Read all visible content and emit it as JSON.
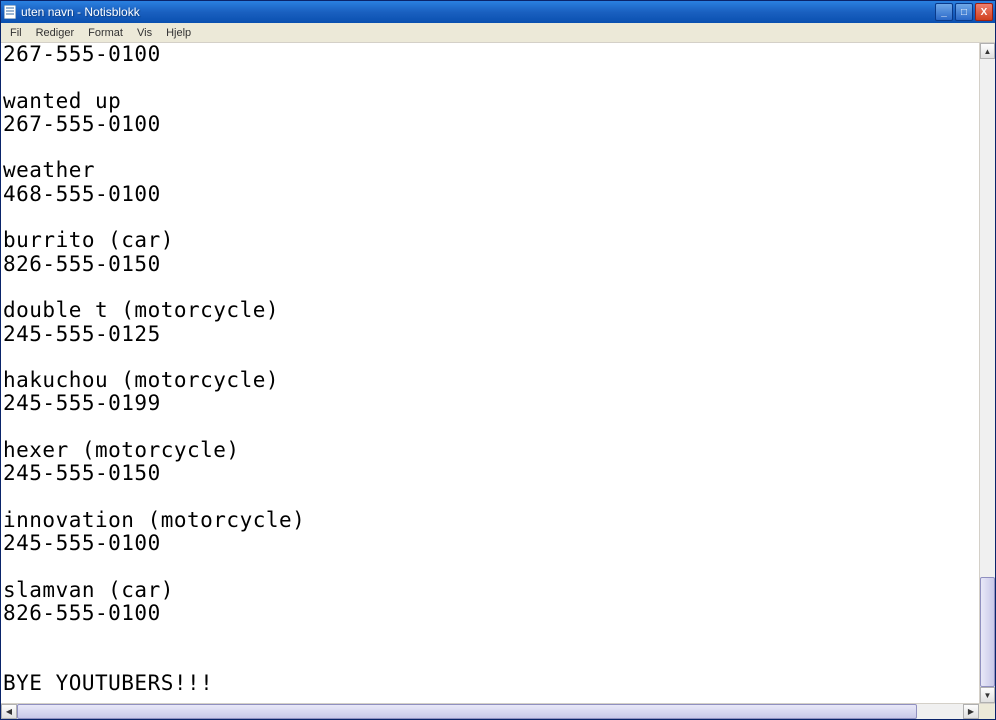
{
  "window": {
    "title": "uten navn - Notisblokk"
  },
  "menu": {
    "fil": "Fil",
    "rediger": "Rediger",
    "format": "Format",
    "vis": "Vis",
    "hjelp": "Hjelp"
  },
  "document": {
    "text": "267-555-0100\n\nwanted up\n267-555-0100\n\nweather\n468-555-0100\n\nburrito (car)\n826-555-0150\n\ndouble t (motorcycle)\n245-555-0125\n\nhakuchou (motorcycle)\n245-555-0199\n\nhexer (motorcycle)\n245-555-0150\n\ninnovation (motorcycle)\n245-555-0100\n\nslamvan (car)\n826-555-0100\n\n\nBYE YOUTUBERS!!!"
  },
  "icons": {
    "minimize": "_",
    "maximize": "□",
    "close": "X",
    "up": "▲",
    "down": "▼",
    "left": "◀",
    "right": "▶"
  }
}
